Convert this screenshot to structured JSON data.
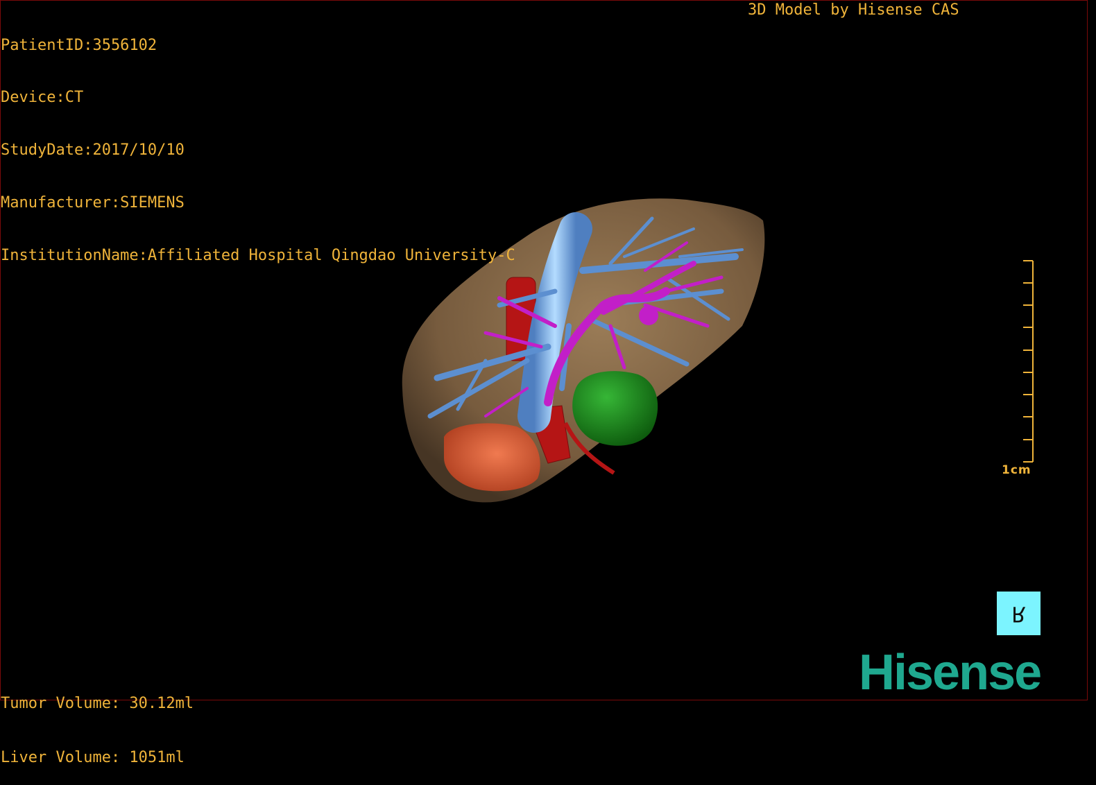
{
  "header": {
    "patient_id": "PatientID:3556102",
    "device": "Device:CT",
    "study_date": "StudyDate:2017/10/10",
    "manufacturer": "Manufacturer:SIEMENS",
    "institution": "InstitutionName:Affiliated Hospital Qingdao University-C"
  },
  "credit": "3D Model by Hisense CAS",
  "volumes": {
    "tumor": "Tumor Volume: 30.12ml",
    "liver": "Liver Volume: 1051ml"
  },
  "scale_bar": {
    "label": "1cm"
  },
  "orientation_marker": {
    "label": "R"
  },
  "brand": {
    "logo_text": "Hisense",
    "logo_color": "#1fa88f"
  },
  "colors": {
    "text": "#f0b43a",
    "liver": "#8a6a45",
    "portal_vein": "#5c8fd0",
    "hepatic_vein": "#c21fc8",
    "artery": "#b51515",
    "tumor_green": "#1e8a1e",
    "tumor_orange": "#d85a32"
  }
}
